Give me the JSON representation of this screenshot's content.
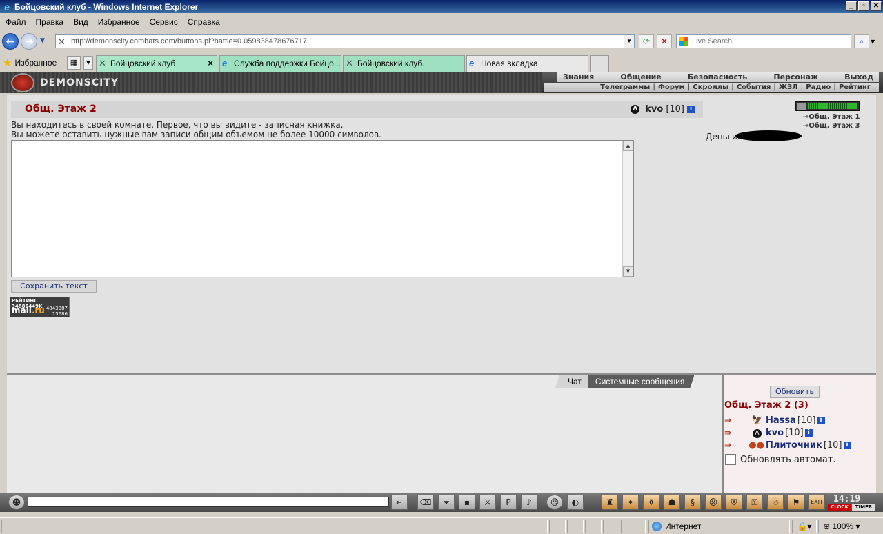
{
  "window": {
    "title": "Бойцовский клуб - Windows Internet Explorer",
    "buttons": [
      "_",
      "▫",
      "✕"
    ]
  },
  "menu": [
    "Файл",
    "Правка",
    "Вид",
    "Избранное",
    "Сервис",
    "Справка"
  ],
  "address": {
    "url": "http://demonscity.combats.com/buttons.pl?battle=0.059838478676717",
    "search_placeholder": "Live Search"
  },
  "favorites_label": "Избранное",
  "tabs": [
    {
      "label": "Бойцовский клуб",
      "active": true
    },
    {
      "label": "Служба поддержки Бойцо..."
    },
    {
      "label": "Бойцовский клуб."
    },
    {
      "label": "Новая вкладка"
    }
  ],
  "site": {
    "logo": "DEMONSCITY",
    "topnav": [
      "Знания",
      "Общение",
      "Безопасность",
      "Персонаж",
      "Выход"
    ],
    "subnav": [
      "Телеграммы",
      "Форум",
      "Скроллы",
      "События",
      "ЖЗЛ",
      "Радио",
      "Рейтинг"
    ]
  },
  "room": {
    "title": "Общ. Этаж 2",
    "user": {
      "name": "kvo",
      "level": "[10]"
    },
    "desc_line1": "Вы находитесь в своей комнате. Первое, что вы видите - записная книжка.",
    "desc_line2": "Вы можете оставить нужные вам записи общим объемом не более 10000 символов.",
    "save_button": "Сохранить текст",
    "exits": [
      "Общ. Этаж 1",
      "Общ. Этаж 3"
    ],
    "money_label": "Деньги:"
  },
  "counter": {
    "line1": "РЕЙТИНГ 34886449K",
    "brand_a": "mail",
    "brand_b": ".ru",
    "num1": "4843387",
    "num2": "15686"
  },
  "chat": {
    "tab_chat": "Чат",
    "tab_system": "Системные сообщения"
  },
  "online": {
    "refresh_button": "Обновить",
    "title": "Общ. Этаж 2 (3)",
    "users": [
      {
        "name": "Hassa",
        "level": "[10]"
      },
      {
        "name": "kvo",
        "level": "[10]"
      },
      {
        "name": "Плиточник",
        "level": "[10]"
      }
    ],
    "auto_refresh": "Обновлять автомат."
  },
  "clock": {
    "time": "14:19",
    "clock_label": "CLOCK",
    "timer_label": "TIMER"
  },
  "status": {
    "zone": "Интернет",
    "zoom": "100%"
  }
}
